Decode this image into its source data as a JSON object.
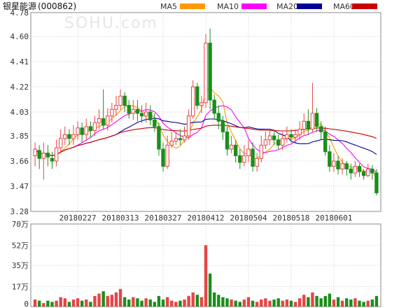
{
  "title": "银星能源",
  "code": "(000862)",
  "watermark": "SOHU.com",
  "legend": [
    {
      "label": "MA5",
      "color": "#ff9900"
    },
    {
      "label": "MA10",
      "color": "#ff00ff"
    },
    {
      "label": "MA20",
      "color": "#000099"
    },
    {
      "label": "MA60",
      "color": "#cc0000"
    }
  ],
  "colors": {
    "up": "#e64545",
    "down": "#1a8f1a",
    "grid": "#cccccc",
    "axis": "#666666"
  },
  "chart_data": [
    {
      "type": "candlestick",
      "y_ticks": [
        "4.78",
        "4.60",
        "4.41",
        "4.22",
        "4.03",
        "3.85",
        "3.66",
        "3.47",
        "3.28"
      ],
      "ylim": [
        3.28,
        4.78
      ],
      "x_labels": [
        {
          "index": 10,
          "label": "20180227"
        },
        {
          "index": 20,
          "label": "20180313"
        },
        {
          "index": 30,
          "label": "20180327"
        },
        {
          "index": 40,
          "label": "20180412"
        },
        {
          "index": 50,
          "label": "20180504"
        },
        {
          "index": 60,
          "label": "20180518"
        },
        {
          "index": 70,
          "label": "20180601"
        }
      ],
      "candles": [
        [
          3.7,
          3.75,
          3.8,
          3.62
        ],
        [
          3.74,
          3.68,
          3.78,
          3.6
        ],
        [
          3.68,
          3.72,
          3.8,
          3.52
        ],
        [
          3.72,
          3.69,
          3.78,
          3.62
        ],
        [
          3.68,
          3.66,
          3.73,
          3.6
        ],
        [
          3.66,
          3.76,
          3.82,
          3.62
        ],
        [
          3.76,
          3.83,
          3.9,
          3.72
        ],
        [
          3.83,
          3.86,
          3.92,
          3.78
        ],
        [
          3.86,
          3.83,
          3.9,
          3.78
        ],
        [
          3.83,
          3.86,
          3.93,
          3.78
        ],
        [
          3.86,
          3.91,
          3.96,
          3.82
        ],
        [
          3.91,
          3.86,
          3.95,
          3.8
        ],
        [
          3.86,
          3.92,
          3.98,
          3.82
        ],
        [
          3.92,
          3.89,
          3.96,
          3.84
        ],
        [
          3.89,
          3.95,
          4.0,
          3.85
        ],
        [
          3.95,
          3.98,
          4.05,
          3.9
        ],
        [
          3.98,
          3.93,
          4.2,
          3.9
        ],
        [
          3.93,
          4.0,
          4.06,
          3.89
        ],
        [
          4.0,
          4.05,
          4.1,
          3.95
        ],
        [
          4.05,
          4.08,
          4.15,
          4.0
        ],
        [
          4.08,
          4.15,
          4.2,
          4.05
        ],
        [
          4.15,
          4.08,
          4.18,
          4.03
        ],
        [
          4.08,
          4.02,
          4.12,
          3.98
        ],
        [
          4.02,
          4.05,
          4.12,
          3.97
        ],
        [
          4.05,
          4.02,
          4.12,
          3.96
        ],
        [
          4.02,
          4.0,
          4.08,
          3.95
        ],
        [
          4.0,
          4.03,
          4.1,
          3.95
        ],
        [
          4.03,
          3.97,
          4.08,
          3.93
        ],
        [
          3.97,
          3.92,
          4.02,
          3.88
        ],
        [
          3.92,
          3.75,
          3.95,
          3.7
        ],
        [
          3.75,
          3.62,
          3.8,
          3.58
        ],
        [
          3.62,
          3.78,
          3.85,
          3.6
        ],
        [
          3.78,
          3.81,
          3.88,
          3.76
        ],
        [
          3.81,
          3.83,
          3.88,
          3.78
        ],
        [
          3.83,
          3.82,
          3.9,
          3.78
        ],
        [
          3.82,
          3.85,
          3.92,
          3.8
        ],
        [
          3.85,
          4.0,
          4.05,
          3.82
        ],
        [
          4.0,
          4.22,
          4.27,
          3.98
        ],
        [
          4.22,
          4.08,
          4.25,
          4.05
        ],
        [
          4.08,
          4.1,
          4.15,
          4.02
        ],
        [
          4.1,
          4.55,
          4.62,
          4.06
        ],
        [
          4.55,
          4.12,
          4.66,
          4.05
        ],
        [
          4.12,
          4.02,
          4.16,
          3.97
        ],
        [
          4.02,
          3.96,
          4.08,
          3.9
        ],
        [
          3.96,
          3.88,
          4.0,
          3.82
        ],
        [
          3.88,
          3.75,
          3.92,
          3.7
        ],
        [
          3.75,
          3.78,
          3.85,
          3.72
        ],
        [
          3.78,
          3.7,
          3.82,
          3.65
        ],
        [
          3.7,
          3.65,
          3.75,
          3.6
        ],
        [
          3.65,
          3.7,
          3.78,
          3.62
        ],
        [
          3.7,
          3.75,
          3.82,
          3.65
        ],
        [
          3.75,
          3.62,
          3.8,
          3.58
        ],
        [
          3.62,
          3.68,
          3.72,
          3.58
        ],
        [
          3.68,
          3.78,
          3.85,
          3.65
        ],
        [
          3.78,
          3.82,
          3.88,
          3.75
        ],
        [
          3.82,
          3.85,
          3.9,
          3.78
        ],
        [
          3.85,
          3.82,
          3.9,
          3.78
        ],
        [
          3.82,
          3.78,
          3.86,
          3.75
        ],
        [
          3.78,
          3.83,
          3.88,
          3.74
        ],
        [
          3.83,
          3.86,
          3.92,
          3.8
        ],
        [
          3.86,
          3.84,
          3.9,
          3.8
        ],
        [
          3.84,
          3.86,
          3.9,
          3.8
        ],
        [
          3.86,
          3.9,
          3.96,
          3.82
        ],
        [
          3.9,
          3.96,
          4.02,
          3.86
        ],
        [
          3.96,
          3.9,
          4.05,
          3.86
        ],
        [
          3.9,
          4.02,
          4.25,
          3.88
        ],
        [
          4.02,
          3.92,
          4.06,
          3.88
        ],
        [
          3.92,
          3.88,
          3.96,
          3.82
        ],
        [
          3.88,
          3.73,
          3.92,
          3.7
        ],
        [
          3.73,
          3.62,
          3.78,
          3.58
        ],
        [
          3.62,
          3.66,
          3.72,
          3.58
        ],
        [
          3.66,
          3.6,
          3.7,
          3.56
        ],
        [
          3.6,
          3.64,
          3.68,
          3.56
        ],
        [
          3.64,
          3.6,
          3.66,
          3.55
        ],
        [
          3.6,
          3.57,
          3.64,
          3.52
        ],
        [
          3.57,
          3.62,
          3.66,
          3.54
        ],
        [
          3.62,
          3.58,
          3.64,
          3.54
        ],
        [
          3.58,
          3.55,
          3.6,
          3.52
        ],
        [
          3.55,
          3.6,
          3.64,
          3.54
        ],
        [
          3.6,
          3.57,
          3.63,
          3.52
        ],
        [
          3.57,
          3.42,
          3.6,
          3.4
        ]
      ]
    },
    {
      "type": "bar",
      "y_ticks": [
        "70万",
        "52万",
        "35万",
        "17万",
        "0"
      ],
      "ylim": [
        0,
        70
      ],
      "volume": [
        6,
        5,
        3,
        5,
        4,
        5,
        8,
        7,
        4,
        6,
        7,
        5,
        6,
        4,
        9,
        11,
        13,
        9,
        10,
        12,
        15,
        8,
        6,
        8,
        7,
        5,
        7,
        6,
        4,
        9,
        6,
        8,
        5,
        4,
        5,
        6,
        9,
        12,
        10,
        8,
        52,
        28,
        12,
        10,
        8,
        7,
        6,
        5,
        4,
        6,
        8,
        5,
        4,
        6,
        7,
        5,
        6,
        7,
        5,
        6,
        5,
        4,
        7,
        10,
        8,
        12,
        9,
        7,
        9,
        11,
        6,
        8,
        5,
        7,
        6,
        7,
        5,
        4,
        5,
        6,
        9
      ]
    }
  ]
}
